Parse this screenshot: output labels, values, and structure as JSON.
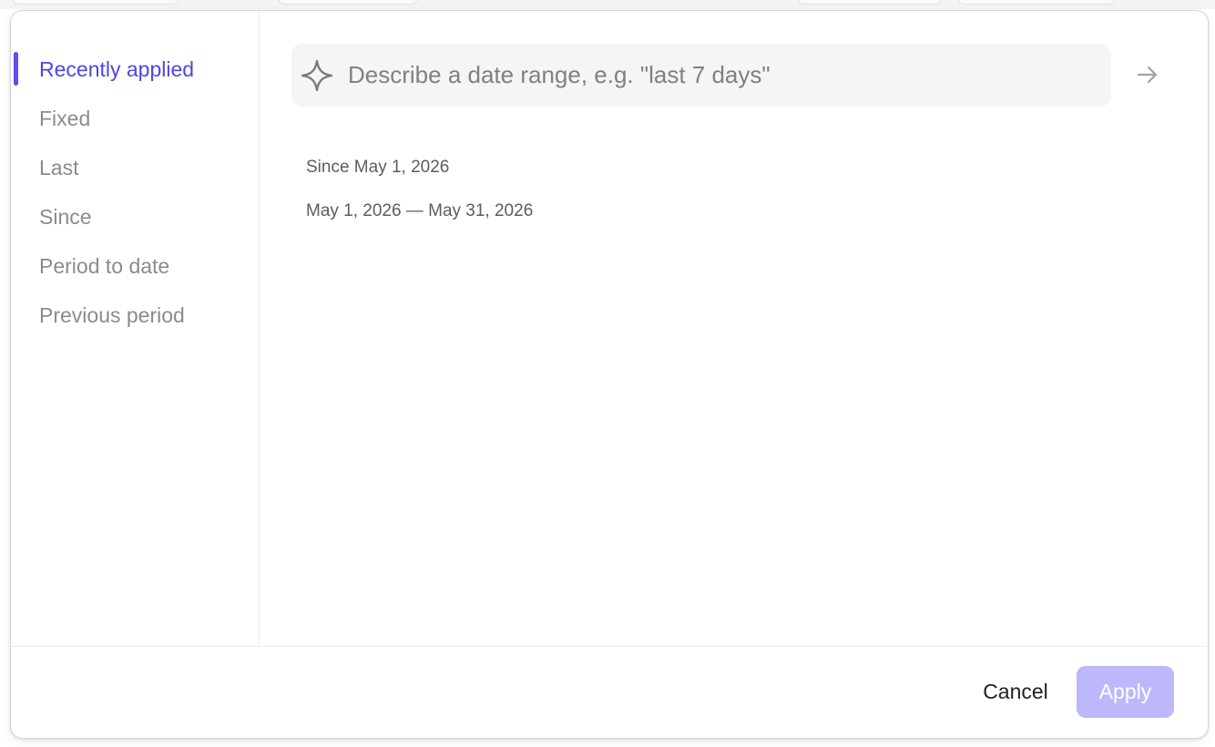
{
  "sidebar": {
    "items": [
      {
        "label": "Recently applied",
        "active": true
      },
      {
        "label": "Fixed",
        "active": false
      },
      {
        "label": "Last",
        "active": false
      },
      {
        "label": "Since",
        "active": false
      },
      {
        "label": "Period to date",
        "active": false
      },
      {
        "label": "Previous period",
        "active": false
      }
    ]
  },
  "search": {
    "placeholder": "Describe a date range, e.g. \"last 7 days\"",
    "value": "",
    "icon": "sparkle-icon",
    "submit_icon": "arrow-right-icon"
  },
  "recent": {
    "items": [
      {
        "label": "Since May 1, 2026"
      },
      {
        "label": "May 1, 2026 — May 31, 2026"
      }
    ]
  },
  "footer": {
    "cancel_label": "Cancel",
    "apply_label": "Apply",
    "apply_disabled": true
  },
  "colors": {
    "accent": "#4f46e5",
    "accent_bar": "#5b50f0",
    "apply_disabled_bg": "#bdb8fb",
    "muted_text": "#8b8b8f"
  }
}
